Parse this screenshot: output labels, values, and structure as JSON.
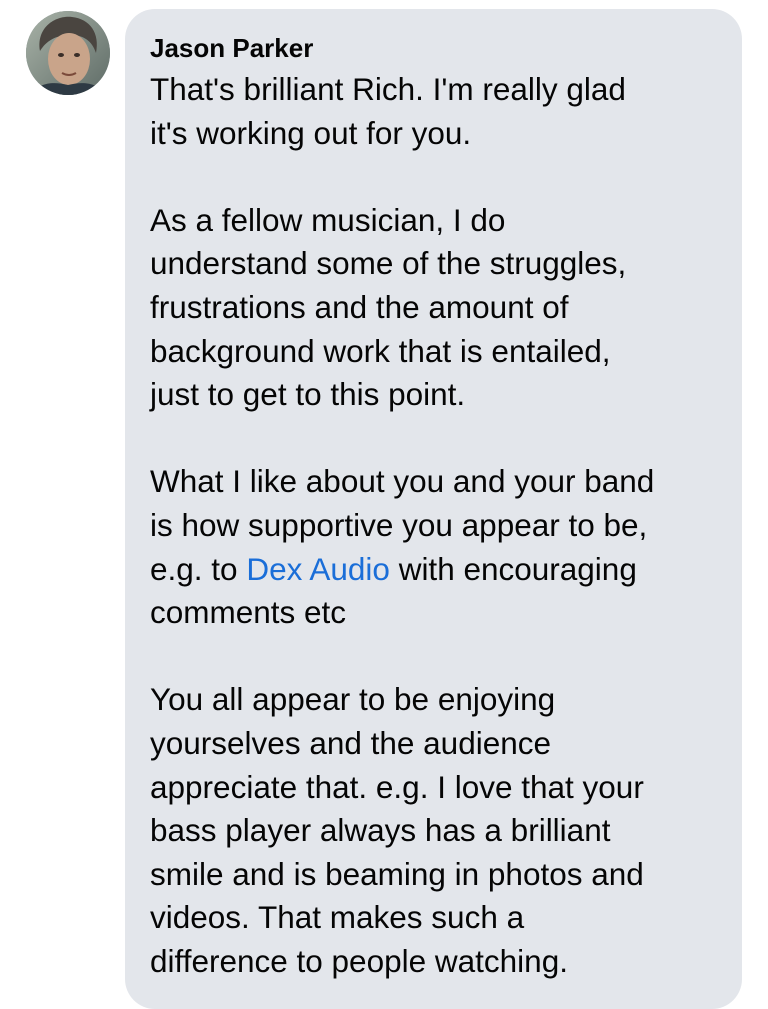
{
  "message": {
    "sender_name": "Jason Parker",
    "paragraphs": [
      {
        "lines": [
          "That's brilliant Rich. I'm really glad",
          "it's working out for you."
        ]
      },
      {
        "lines": [
          "As a fellow musician, I do",
          "understand some of the struggles,",
          "frustrations and the amount of",
          "background work that is entailed,",
          "just to get to this point."
        ]
      },
      {
        "lines": [
          "What I like about you and your band",
          "is how supportive you appear to be,"
        ],
        "link_line": {
          "before": "e.g. to ",
          "link_text": "Dex Audio",
          "after": " with encouraging"
        },
        "after_lines": [
          "comments etc"
        ]
      },
      {
        "lines": [
          "You all appear to be enjoying",
          "yourselves and the audience",
          "appreciate that. e.g. I love that your",
          "bass player always has a brilliant",
          "smile and is beaming in photos and",
          "videos. That makes such a",
          "difference to people watching."
        ]
      }
    ]
  },
  "icons": {
    "avatar": "profile-photo"
  },
  "colors": {
    "bubble_background": "#e3e6eb",
    "text": "#050505",
    "link": "#1a6ed8"
  }
}
